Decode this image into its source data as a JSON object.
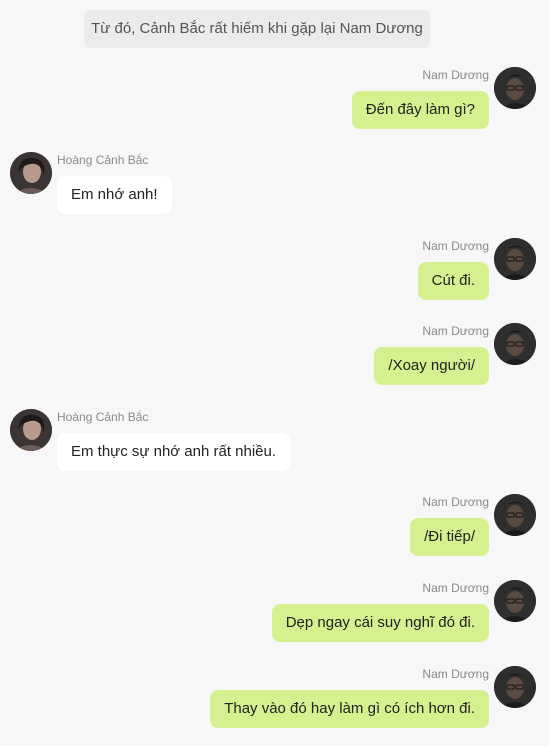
{
  "system_message": "Từ đó, Cảnh Bắc rất hiếm khi gặp lại Nam Dương",
  "messages": [
    {
      "sender": "Nam Dương",
      "text": "Đến đây làm gì?"
    },
    {
      "sender": "Hoàng Cảnh Bắc",
      "text": "Em nhớ anh!"
    },
    {
      "sender": "Nam Dương",
      "text": "Cút đi."
    },
    {
      "sender": "Nam Dương",
      "text": "/Xoay người/"
    },
    {
      "sender": "Hoàng Cảnh Bắc",
      "text": "Em thực sự nhớ anh rất nhiều."
    },
    {
      "sender": "Nam Dương",
      "text": "/Đi tiếp/"
    },
    {
      "sender": "Nam Dương",
      "text": "Dẹp ngay cái suy nghĩ đó đi."
    },
    {
      "sender": "Nam Dương",
      "text": "Thay vào đó hay làm gì có ích hơn đi."
    }
  ],
  "colors": {
    "background": "#f7f7f7",
    "outgoing_bubble": "#d5f08f",
    "incoming_bubble": "#ffffff",
    "system_bubble": "#ebebeb"
  }
}
